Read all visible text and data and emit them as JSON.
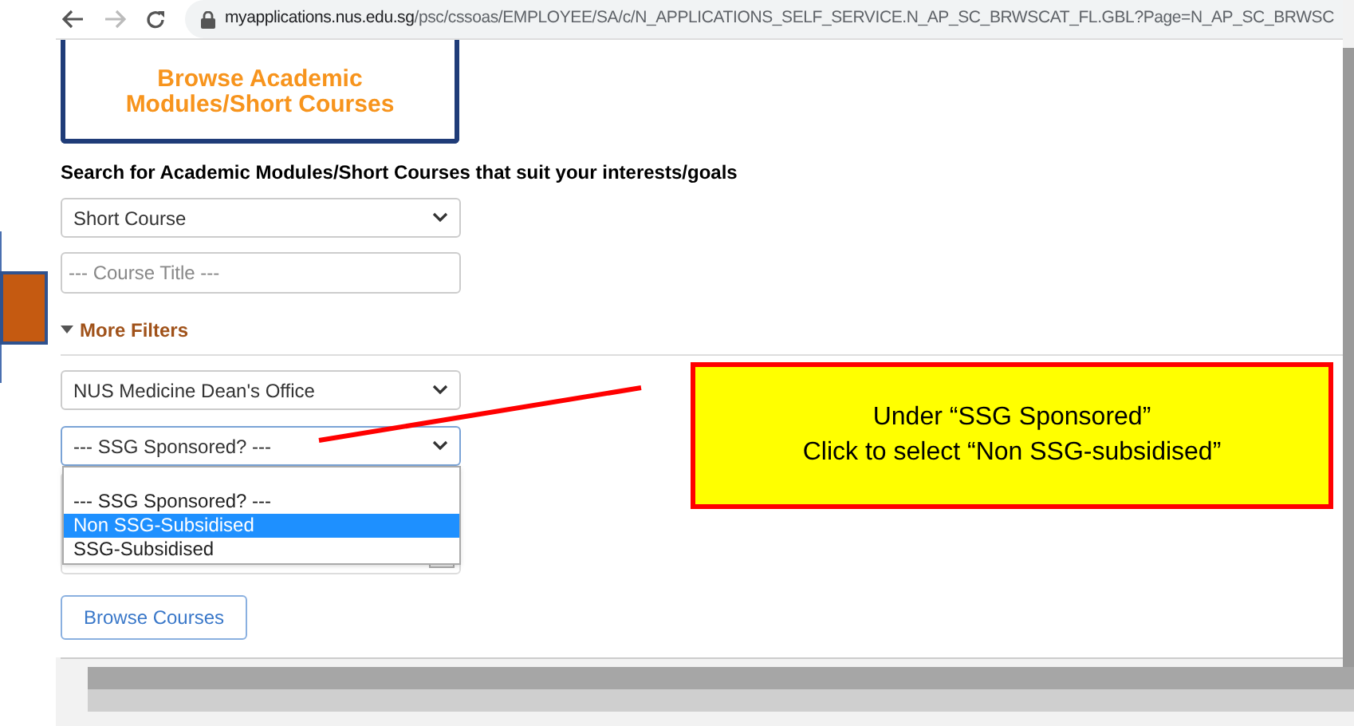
{
  "browser": {
    "url_host": "myapplications.nus.edu.sg",
    "url_path": "/psc/cssoas/EMPLOYEE/SA/c/N_APPLICATIONS_SELF_SERVICE.N_AP_SC_BRWSCAT_FL.GBL?Page=N_AP_SC_BRWSC"
  },
  "banner": {
    "title": "Browse Academic Modules/Short Courses"
  },
  "search_heading": "Search for Academic Modules/Short Courses that suit your interests/goals",
  "course_type": {
    "value": "Short Course"
  },
  "course_title": {
    "placeholder": "--- Course Title ---"
  },
  "more_filters": {
    "label": "More Filters",
    "expanded": true
  },
  "department": {
    "value": "NUS Medicine Dean's Office"
  },
  "ssg_sponsored": {
    "value": "--- SSG Sponsored? ---",
    "options": [
      {
        "label": "--- SSG Sponsored? ---",
        "highlighted": false
      },
      {
        "label": "Non SSG-Subsidised",
        "highlighted": true
      },
      {
        "label": "SSG-Subsidised",
        "highlighted": false
      }
    ]
  },
  "browse_button": "Browse Courses",
  "callout": {
    "lines": [
      "Under “SSG Sponsored”",
      "Click to select “Non SSG-subsidised”"
    ]
  }
}
